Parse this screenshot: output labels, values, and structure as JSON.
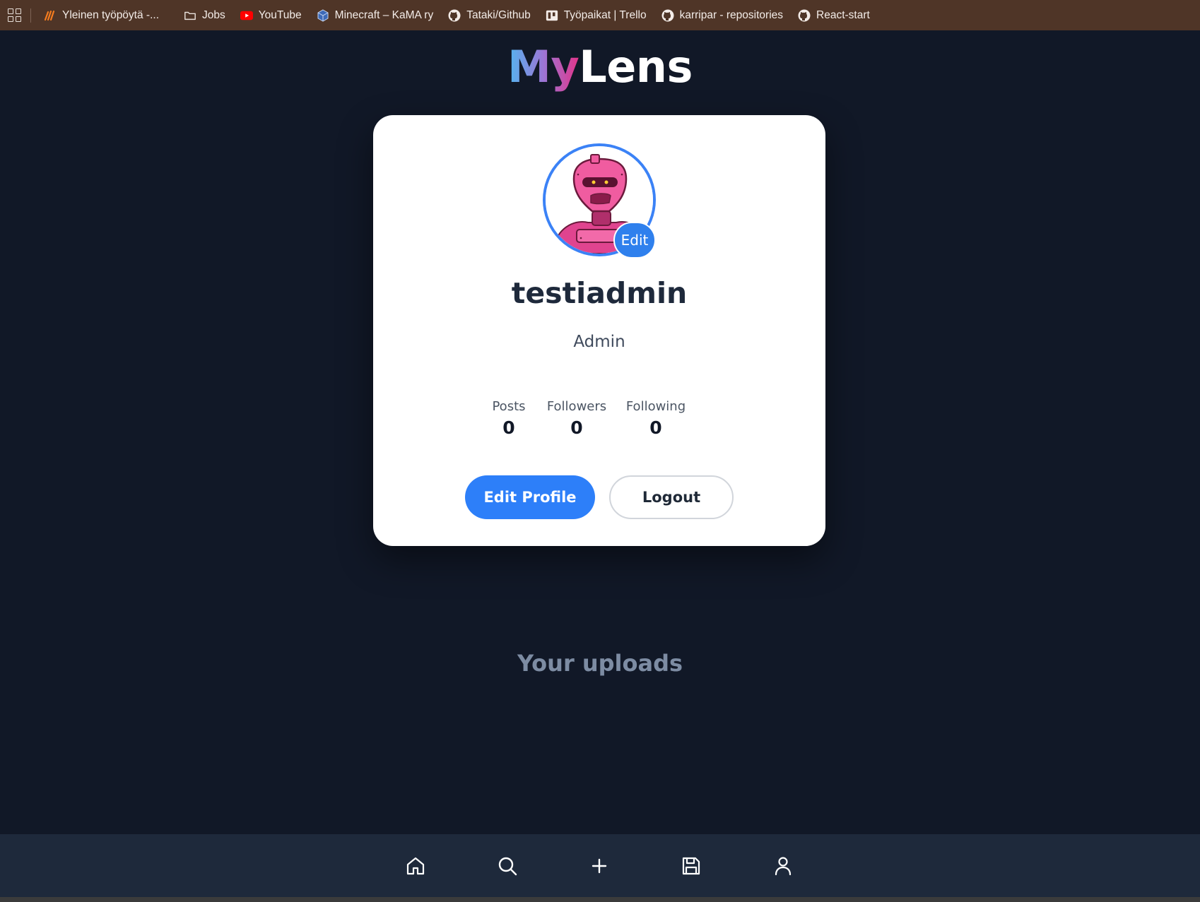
{
  "bookmarks": [
    {
      "label": "Yleinen työpöytä -...",
      "icon": "moodle-icon"
    },
    {
      "label": "Jobs",
      "icon": "folder-icon"
    },
    {
      "label": "YouTube",
      "icon": "youtube-icon"
    },
    {
      "label": "Minecraft – KaMA ry",
      "icon": "cube-icon"
    },
    {
      "label": "Tataki/Github",
      "icon": "github-icon"
    },
    {
      "label": "Työpaikat | Trello",
      "icon": "trello-icon"
    },
    {
      "label": "karripar - repositories",
      "icon": "github-icon"
    },
    {
      "label": "React-start",
      "icon": "github-icon"
    }
  ],
  "logo": {
    "my": "My",
    "lens": "Lens"
  },
  "profile": {
    "avatar_edit_label": "Edit",
    "username": "testiadmin",
    "role": "Admin",
    "stats": [
      {
        "label": "Posts",
        "value": "0"
      },
      {
        "label": "Followers",
        "value": "0"
      },
      {
        "label": "Following",
        "value": "0"
      }
    ],
    "edit_profile_label": "Edit Profile",
    "logout_label": "Logout"
  },
  "uploads_heading": "Your uploads",
  "bottom_nav": [
    "home-icon",
    "search-icon",
    "plus-icon",
    "save-icon",
    "user-icon"
  ],
  "colors": {
    "accent": "#2d7ff9",
    "background": "#111827",
    "nav": "#1e293b",
    "bookmarks_bar": "#4f3527"
  }
}
